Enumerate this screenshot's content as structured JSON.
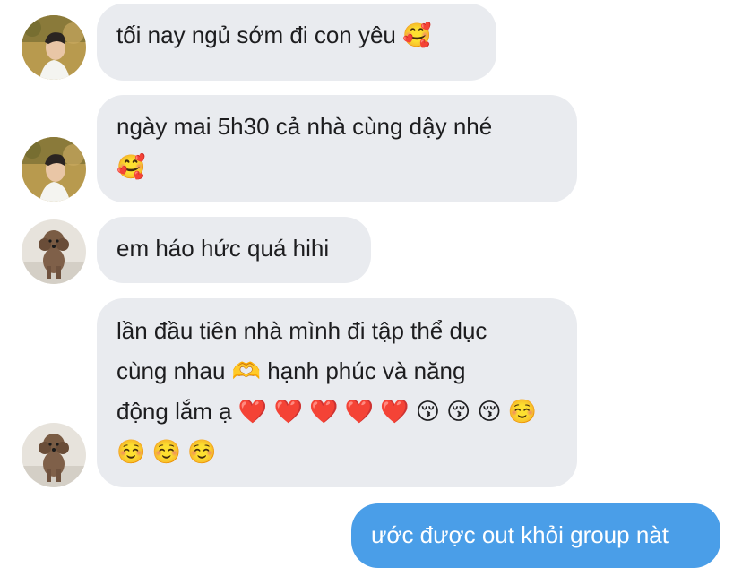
{
  "colors": {
    "incoming_bubble": "#e9ebef",
    "outgoing_bubble": "#4a9ee8",
    "incoming_text": "#1d1d1f",
    "outgoing_text": "#ffffff"
  },
  "messages": [
    {
      "direction": "incoming",
      "avatar": "boy-avatar",
      "lines": [
        "tối nay ngủ sớm đi con yêu 🥰"
      ]
    },
    {
      "direction": "incoming",
      "avatar": "boy-avatar",
      "lines": [
        "ngày mai 5h30 cả nhà cùng dậy nhé",
        "🥰"
      ]
    },
    {
      "direction": "incoming",
      "avatar": "poodle-avatar",
      "lines": [
        "em háo hức quá hihi"
      ]
    },
    {
      "direction": "incoming",
      "avatar": "poodle-avatar",
      "lines": [
        "lần đầu tiên nhà mình đi tập thể dục",
        "cùng nhau 🫶 hạnh phúc và năng",
        "động lắm ạ ❤️ ❤️ ❤️ ❤️ ❤️ 😚 😚 😚 ☺️",
        "☺️ ☺️ ☺️"
      ]
    },
    {
      "direction": "outgoing",
      "lines": [
        "ước được out khỏi group nàt"
      ]
    }
  ]
}
